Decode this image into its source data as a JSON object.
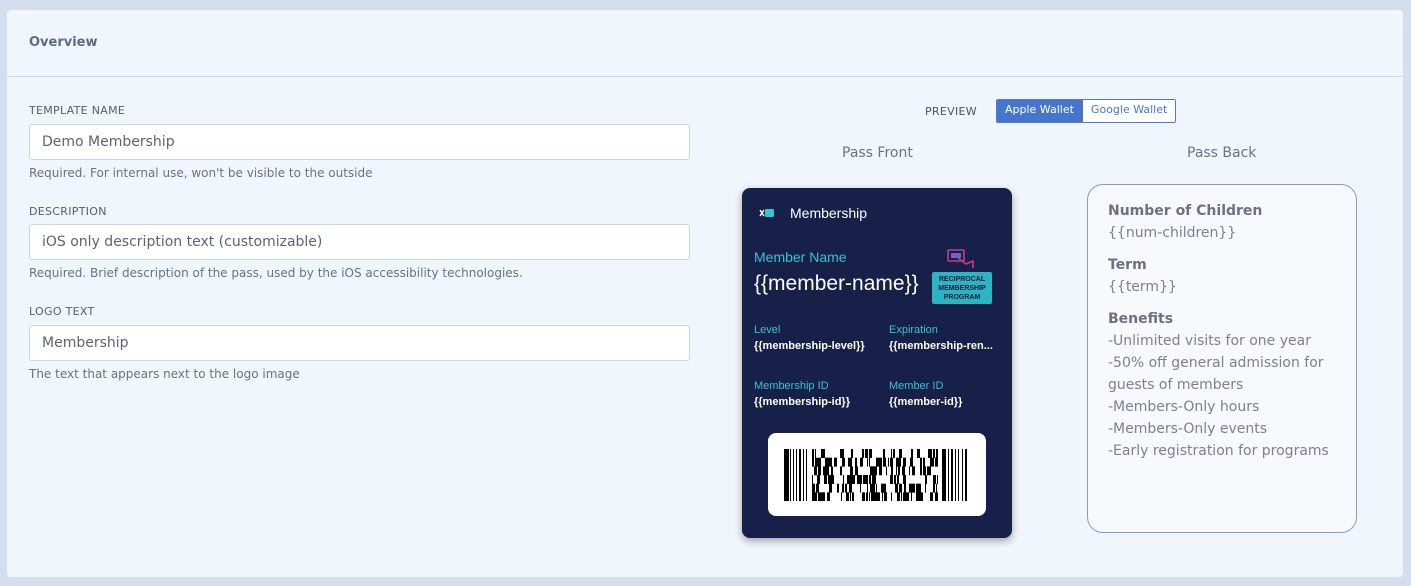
{
  "panel": {
    "title": "Overview"
  },
  "form": {
    "template_name": {
      "label": "TEMPLATE NAME",
      "value": "Demo Membership",
      "help": "Required. For internal use, won't be visible to the outside"
    },
    "description": {
      "label": "DESCRIPTION",
      "value": "iOS only description text (customizable)",
      "help": "Required. Brief description of the pass, used by the iOS accessibility technologies."
    },
    "logo_text": {
      "label": "LOGO TEXT",
      "value": "Membership",
      "help": "The text that appears next to the logo image"
    }
  },
  "preview": {
    "label": "PREVIEW",
    "toggle": {
      "apple": "Apple Wallet",
      "google": "Google Wallet",
      "selected": "apple"
    }
  },
  "pass_front": {
    "heading": "Pass Front",
    "logo_text": "Membership",
    "primary": {
      "label": "Member Name",
      "value": "{{member-name}}"
    },
    "badge": {
      "line1": "RECIPROCAL",
      "line2": "MEMBERSHIP",
      "line3": "PROGRAM"
    },
    "fields": [
      {
        "label": "Level",
        "value": "{{membership-level}}"
      },
      {
        "label": "Expiration",
        "value": "{{membership-ren..."
      },
      {
        "label": "Membership ID",
        "value": "{{membership-id}}"
      },
      {
        "label": "Member ID",
        "value": "{{member-id}}"
      }
    ],
    "colors": {
      "background": "#172048",
      "accent": "#36c3d3"
    }
  },
  "pass_back": {
    "heading": "Pass Back",
    "fields": [
      {
        "label": "Number of Children",
        "value": "{{num-children}}"
      },
      {
        "label": "Term",
        "value": "{{term}}"
      },
      {
        "label": "Benefits",
        "value": "-Unlimited visits for one year\n-50% off general admission for guests of members\n-Members-Only hours\n-Members-Only events\n-Early registration for programs"
      }
    ]
  }
}
